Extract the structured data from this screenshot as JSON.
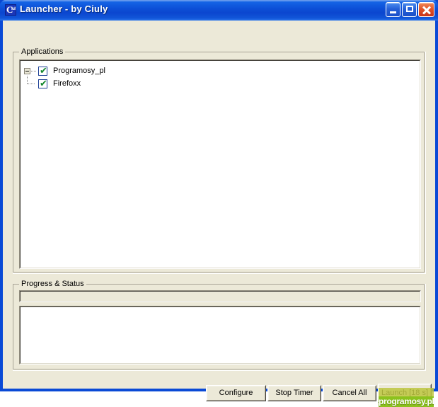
{
  "window": {
    "title": "Launcher - by Ciuly",
    "icon_name": "app-icon",
    "icon_letter": "C",
    "icon_sub": "iuly",
    "colors": {
      "titlebar_blue": "#0a4ad6",
      "client_beige": "#ece9d8",
      "close_red": "#e2552a",
      "check_green": "#12872c",
      "checkbox_border": "#1c3f94",
      "watermark_green": "#8cc21e",
      "watermark_olive": "#bdc640"
    },
    "controls": {
      "minimize": "Minimize",
      "maximize": "Maximize",
      "close": "Close"
    }
  },
  "applications": {
    "group_label": "Applications",
    "tree": [
      {
        "label": "Programosy_pl",
        "checked": true,
        "expanded": true,
        "level": 0
      },
      {
        "label": "Firefoxx",
        "checked": true,
        "expanded": false,
        "level": 1
      }
    ],
    "check_glyph": "✔",
    "expander_glyph": "-"
  },
  "progress": {
    "group_label": "Progress & Status",
    "bar_percent": 0,
    "status_text": ""
  },
  "buttons": {
    "configure": "Configure",
    "stop_timer": "Stop Timer",
    "cancel_all": "Cancel All",
    "launch": "Launch [18 s]"
  },
  "watermark": {
    "text": "programosy.pl"
  }
}
